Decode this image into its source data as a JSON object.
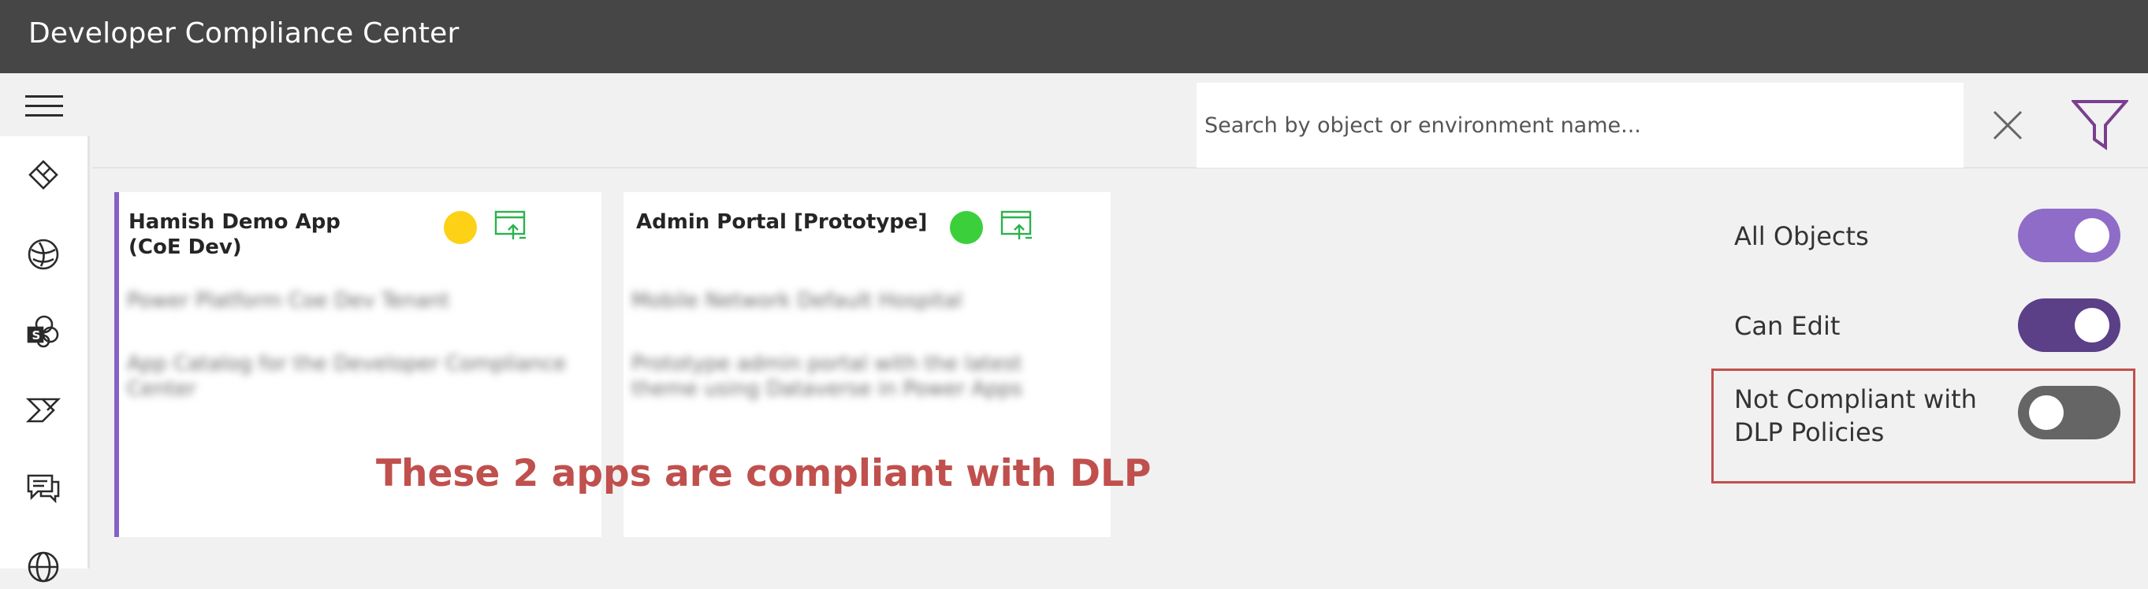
{
  "app": {
    "title": "Developer Compliance Center"
  },
  "search": {
    "placeholder": "Search by object or environment name..."
  },
  "sidebar": {
    "items": [
      {
        "icon": "hamburger-menu-icon"
      },
      {
        "icon": "power-apps-icon"
      },
      {
        "icon": "dataverse-icon"
      },
      {
        "icon": "sharepoint-icon"
      },
      {
        "icon": "power-automate-icon"
      },
      {
        "icon": "power-virtual-agents-icon"
      },
      {
        "icon": "globe-icon"
      }
    ]
  },
  "cards": [
    {
      "name": "Hamish Demo App (CoE Dev)",
      "status_color": "#fcd116",
      "blurred_line_1": "Power Platform Coe Dev Tenant",
      "blurred_line_2": "App Catalog for the Developer Compliance Center"
    },
    {
      "name": "Admin Portal [Prototype]",
      "status_color": "#3ccf3c",
      "blurred_line_1": "Mobile Network Default Hospital",
      "blurred_line_2": "Prototype admin portal with the latest theme using Dataverse in Power Apps"
    }
  ],
  "annotation": "These 2 apps are compliant with DLP",
  "filters": {
    "all_objects": {
      "label": "All Objects",
      "on": true,
      "color": "#8e6cc7"
    },
    "can_edit": {
      "label": "Can Edit",
      "on": true,
      "color": "#5b3f87"
    },
    "not_compliant": {
      "label": "Not Compliant with DLP Policies",
      "on": false,
      "color": "#656565"
    }
  },
  "colors": {
    "accent_purple": "#8661c5",
    "topbar": "#464646",
    "highlight_red": "#c0504d",
    "app_icon_green": "#2bb24c"
  }
}
